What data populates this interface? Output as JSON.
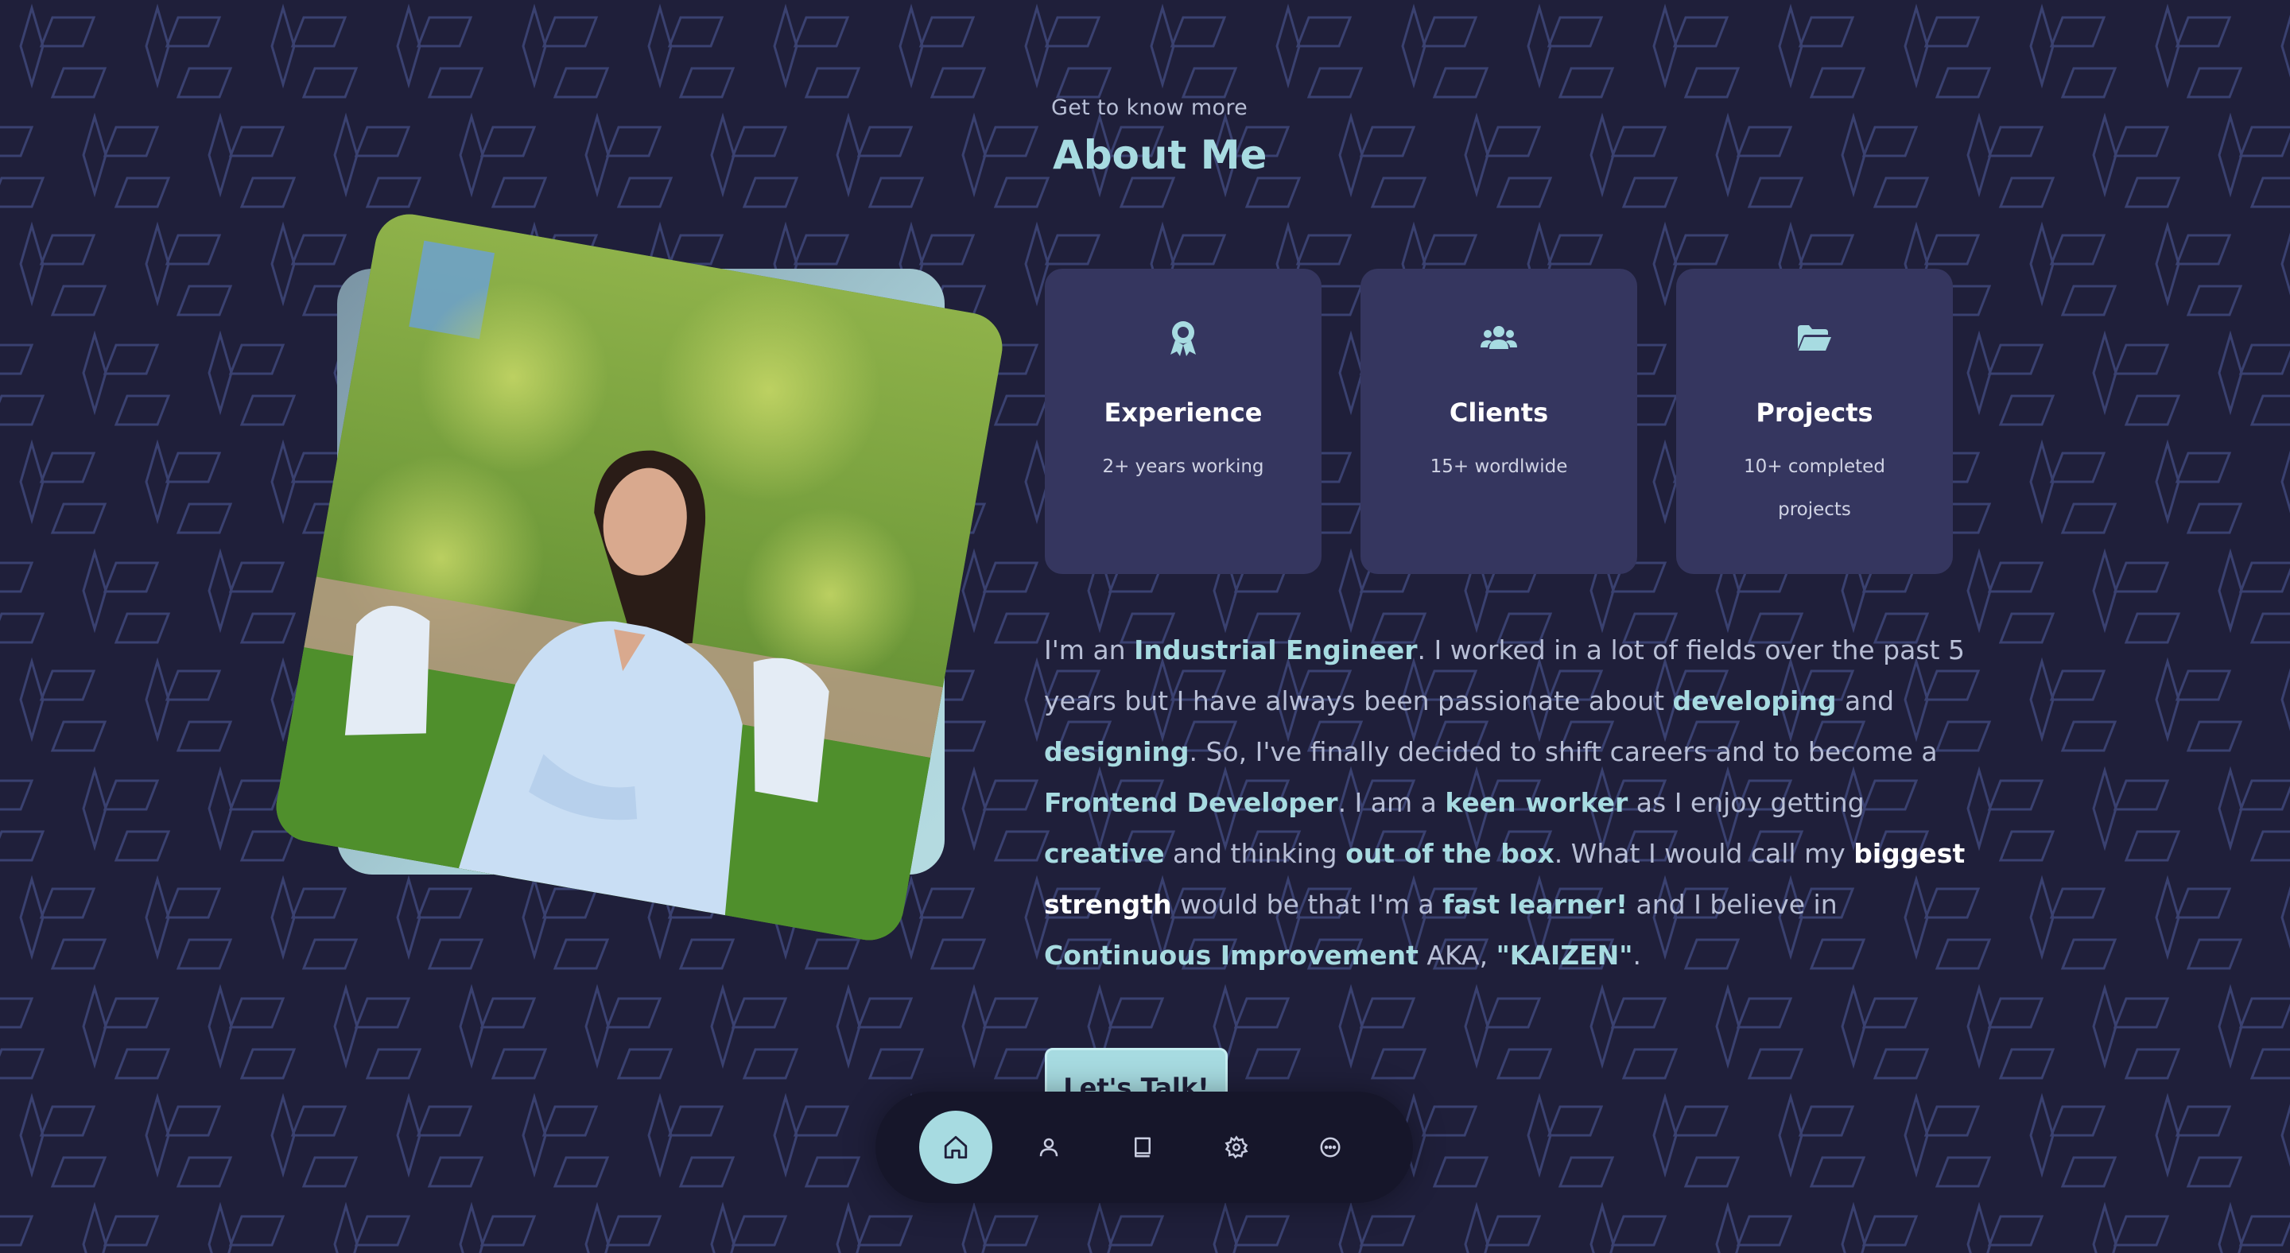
{
  "header": {
    "subtitle": "Get to know more",
    "title": "About Me"
  },
  "cards": [
    {
      "icon": "award-icon",
      "title": "Experience",
      "text": "2+ years working"
    },
    {
      "icon": "users-icon",
      "title": "Clients",
      "text": "15+ wordlwide"
    },
    {
      "icon": "folder-open-icon",
      "title": "Projects",
      "text": "10+ completed projects"
    }
  ],
  "about": {
    "p1": "I'm an ",
    "industrial": "Industrial Engineer",
    "p2": ". I worked in a lot of fields over the past 5 years but I have always been passionate about ",
    "developing": "developing",
    "p3": " and ",
    "designing": "designing",
    "p4": ". So, I've finally decided to shift careers and to become a ",
    "frontend": "Frontend Developer",
    "p5": ". I am a ",
    "keen": "keen worker",
    "p6": " as I enjoy getting ",
    "creative": "creative",
    "p7": " and thinking ",
    "outofbox": "out of the box",
    "p8": ". What I would call my ",
    "strength": "biggest strength",
    "p9": " would be that I'm a ",
    "fast": "fast learner!",
    "p10": " and I believe in ",
    "continuous": "Continuous Improvement",
    "p11": " AKA, ",
    "kaizen": "\"KAIZEN\"",
    "p12": "."
  },
  "cta": {
    "label": "Let's Talk!"
  },
  "nav": {
    "items": [
      {
        "icon": "home-icon",
        "active": true
      },
      {
        "icon": "user-icon",
        "active": false
      },
      {
        "icon": "book-icon",
        "active": false
      },
      {
        "icon": "settings-icon",
        "active": false
      },
      {
        "icon": "chat-icon",
        "active": false
      }
    ]
  },
  "colors": {
    "background": "#1f1f3a",
    "card": "#35365f",
    "accent": "#a7dbe1",
    "pattern": "#3a4170"
  }
}
